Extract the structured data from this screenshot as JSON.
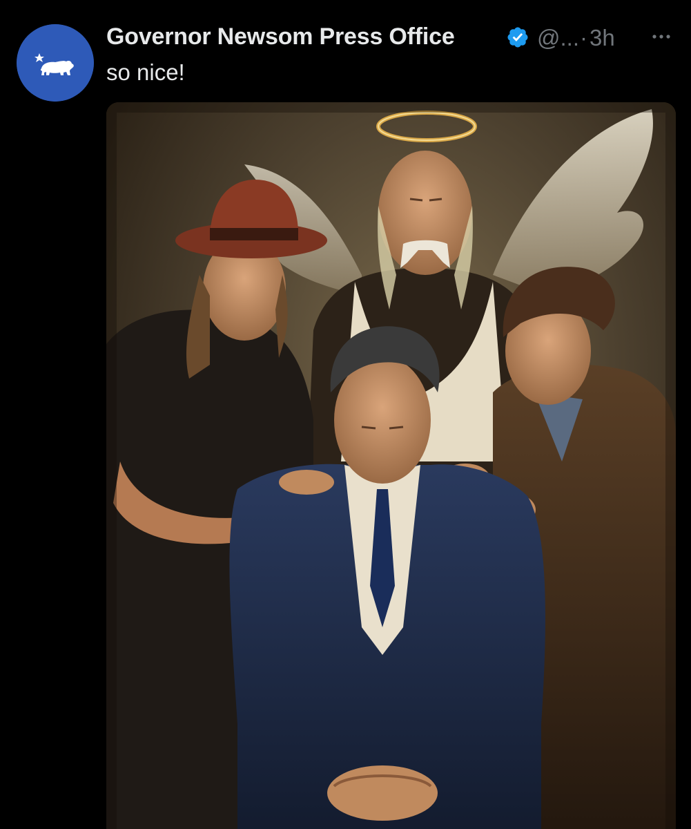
{
  "post": {
    "display_name": "Governor Newsom Press Office",
    "handle": "@...",
    "separator": "·",
    "time": "3h",
    "text": "so nice!"
  },
  "icons": {
    "avatar": "california-bear-flag-icon",
    "verified": "verified-badge-icon",
    "more": "more-options-icon"
  },
  "colors": {
    "background": "#000000",
    "primary_text": "#e7e9ea",
    "secondary_text": "#71767b",
    "verified_blue": "#1d9bf0",
    "avatar_blue": "#2e5ab8"
  },
  "media": {
    "type": "image",
    "subject": "oil-painting"
  }
}
